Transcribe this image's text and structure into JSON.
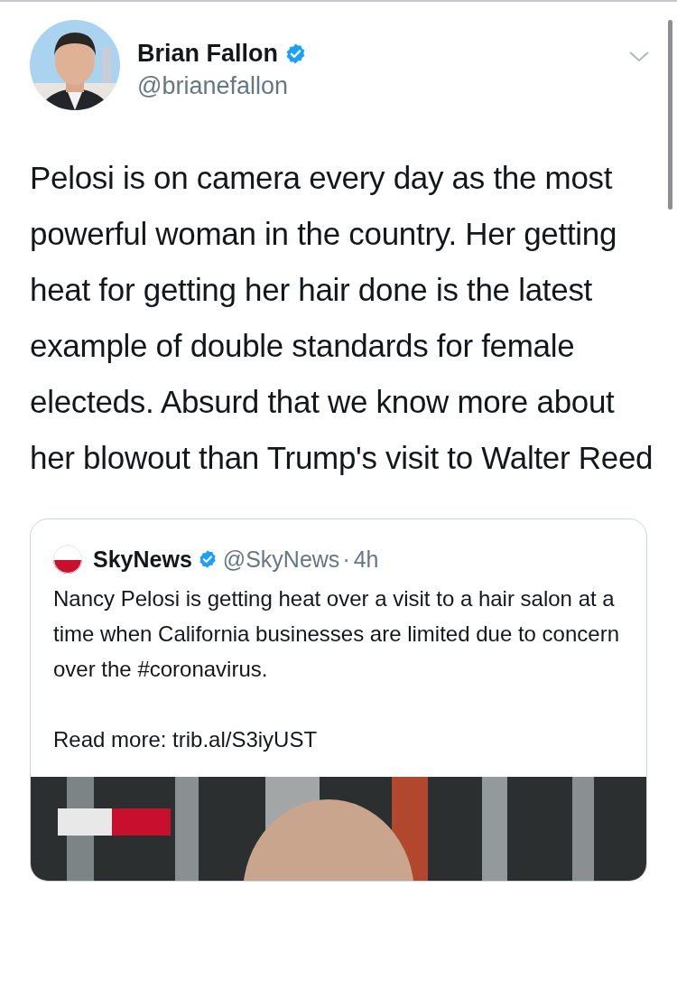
{
  "tweet": {
    "author": {
      "name": "Brian Fallon",
      "verified": true,
      "handle": "@brianefallon"
    },
    "text": "Pelosi is on camera every day as the most powerful woman in the country. Her getting heat for getting her hair done is the latest example of double standards for female electeds. Absurd that we know more about her blowout than Trump's visit to Walter Reed",
    "quoted_tweet": {
      "author": {
        "name": "SkyNews",
        "verified": true,
        "handle": "@SkyNews",
        "separator": "·",
        "time": "4h"
      },
      "text": "Nancy Pelosi is getting heat over a visit to a hair salon at a time when California businesses are limited due to concern over the #coronavirus.",
      "link_line": "Read more: trib.al/S3iyUST"
    }
  }
}
